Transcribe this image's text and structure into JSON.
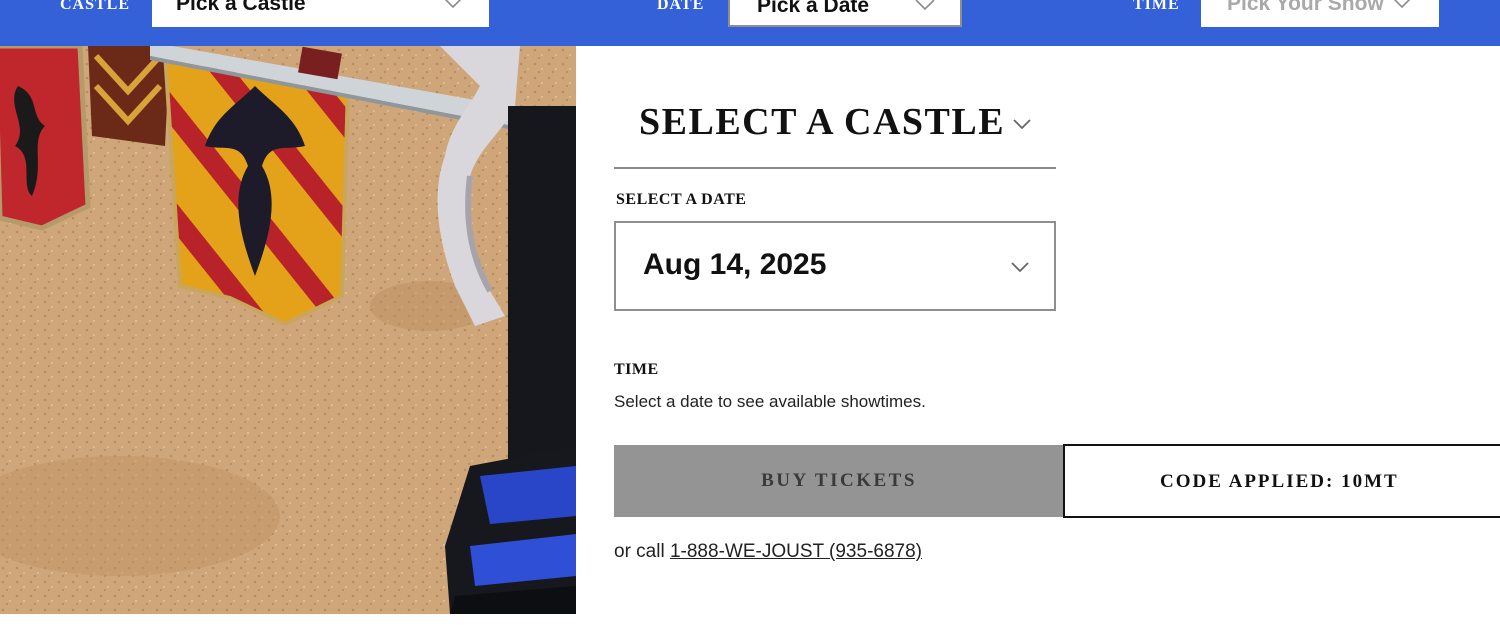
{
  "top_bar": {
    "castle": {
      "label": "CASTLE",
      "value": "Pick a Castle"
    },
    "date": {
      "label": "DATE",
      "value": "Pick a Date"
    },
    "time": {
      "label": "TIME",
      "placeholder": "Pick Your Show"
    },
    "background_color": "#3461d8"
  },
  "hero_image": {
    "icon": "jousting-arena-photo"
  },
  "booking": {
    "castle_heading": "SELECT A CASTLE",
    "date_label": "SELECT A DATE",
    "date_value": "Aug 14, 2025",
    "time_label": "TIME",
    "time_hint": "Select a date to see available showtimes.",
    "buy_button": "BUY TICKETS",
    "code_applied": "CODE APPLIED: 10MT",
    "call_prefix": "or call",
    "phone": "1-888-WE-JOUST (935-6878)"
  },
  "colors": {
    "accent_blue": "#3461d8",
    "disabled_button": "#949494"
  }
}
